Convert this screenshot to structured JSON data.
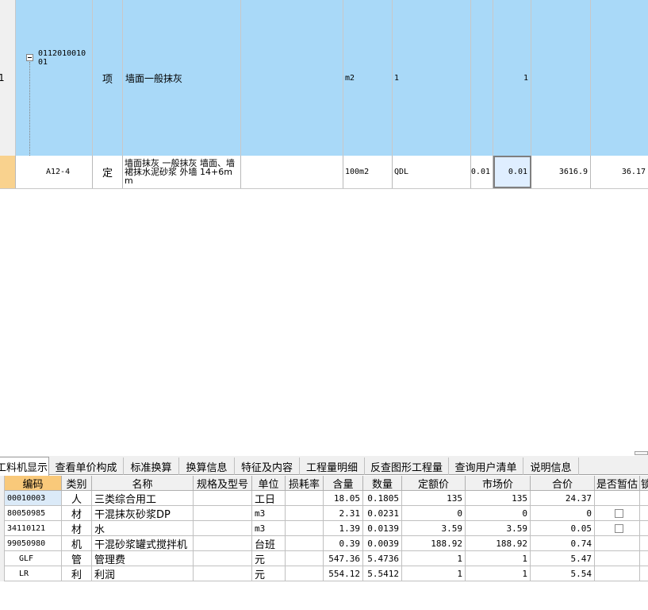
{
  "upper_grid": {
    "rows": [
      {
        "row_no": "1",
        "code_line1": "0112010010",
        "code_line2": "01",
        "category": "项",
        "name": "墙面一般抹灰",
        "unit": "m2",
        "expr": "1",
        "quantity": "1"
      },
      {
        "code": "A12-4",
        "category": "定",
        "name": "墙面抹灰 一般抹灰 墙面、墙裙抹水泥砂浆 外墙 14+6mm",
        "unit": "100m2",
        "expr": "QDL",
        "coef": "0.01",
        "quantity": "0.01",
        "unit_price": "3616.9",
        "total": "36.17"
      }
    ]
  },
  "tabs": [
    {
      "label": "工料机显示",
      "active": true
    },
    {
      "label": "查看单价构成"
    },
    {
      "label": "标准换算"
    },
    {
      "label": "换算信息"
    },
    {
      "label": "特征及内容"
    },
    {
      "label": "工程量明细"
    },
    {
      "label": "反查图形工程量"
    },
    {
      "label": "查询用户清单"
    },
    {
      "label": "说明信息"
    }
  ],
  "lower_grid": {
    "headers": [
      "编码",
      "类别",
      "名称",
      "规格及型号",
      "单位",
      "损耗率",
      "含量",
      "数量",
      "定额价",
      "市场价",
      "合价",
      "是否暂估",
      "锁"
    ],
    "rows": [
      {
        "code": "00010003",
        "type": "人",
        "name": "三类综合用工",
        "unit": "工日",
        "content": "18.05",
        "qty": "0.1805",
        "quota_price": "135",
        "market_price": "135",
        "total": "24.37",
        "checkbox": false
      },
      {
        "code": "80050985",
        "type": "材",
        "name": "干混抹灰砂浆DP",
        "unit": "m3",
        "content": "2.31",
        "qty": "0.0231",
        "quota_price": "0",
        "market_price": "0",
        "total": "0",
        "checkbox": true
      },
      {
        "code": "34110121",
        "type": "材",
        "name": "水",
        "unit": "m3",
        "content": "1.39",
        "qty": "0.0139",
        "quota_price": "3.59",
        "market_price": "3.59",
        "total": "0.05",
        "checkbox": true
      },
      {
        "code": "99050980",
        "type": "机",
        "name": "干混砂浆罐式搅拌机",
        "unit": "台班",
        "content": "0.39",
        "qty": "0.0039",
        "quota_price": "188.92",
        "market_price": "188.92",
        "total": "0.74",
        "checkbox": false
      },
      {
        "code": "GLF",
        "type": "管",
        "name": "管理费",
        "unit": "元",
        "content": "547.36",
        "qty": "5.4736",
        "quota_price": "1",
        "market_price": "1",
        "total": "5.47",
        "checkbox": false
      },
      {
        "code": "LR",
        "type": "利",
        "name": "利润",
        "unit": "元",
        "content": "554.12",
        "qty": "5.5412",
        "quota_price": "1",
        "market_price": "1",
        "total": "5.54",
        "checkbox": false
      }
    ]
  }
}
